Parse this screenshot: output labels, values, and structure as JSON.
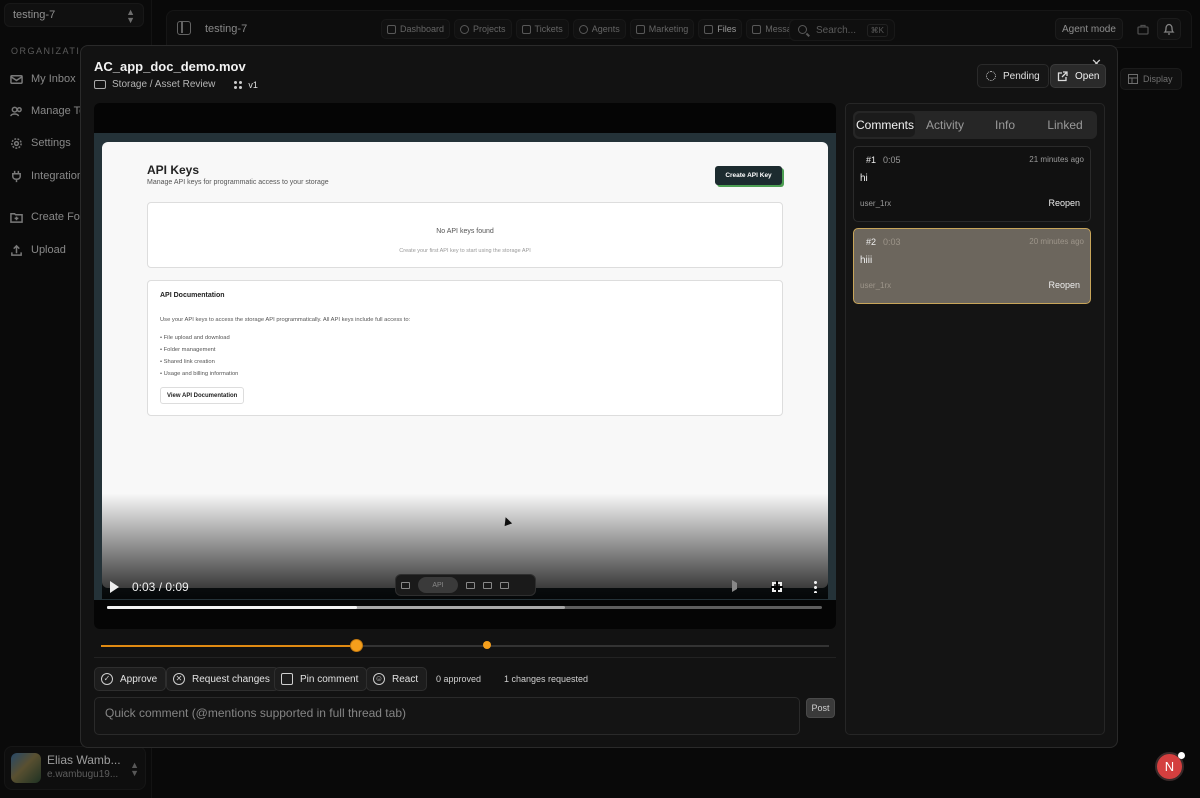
{
  "sidebar": {
    "workspace": "testing-7",
    "section_label": "ORGANIZATION",
    "items": [
      {
        "label": "My Inbox"
      },
      {
        "label": "Manage Te"
      },
      {
        "label": "Settings"
      },
      {
        "label": "Integration"
      },
      {
        "label": "Create Fol"
      },
      {
        "label": "Upload"
      }
    ],
    "user": {
      "name": "Elias Wamb...",
      "email": "e.wambugu19..."
    }
  },
  "topbar": {
    "title": "testing-7",
    "tabs": [
      {
        "label": "Dashboard"
      },
      {
        "label": "Projects"
      },
      {
        "label": "Tickets"
      },
      {
        "label": "Agents"
      },
      {
        "label": "Marketing"
      },
      {
        "label": "Files"
      },
      {
        "label": "Messages"
      }
    ],
    "search_placeholder": "Search...",
    "search_shortcut": "⌘K",
    "agent_mode_label": "Agent mode",
    "display_label": "Display"
  },
  "modal": {
    "filename": "AC_app_doc_demo.mov",
    "breadcrumb": "Storage / Asset Review",
    "version": "v1",
    "status_label": "Pending",
    "open_label": "Open",
    "close_glyph": "✕"
  },
  "video_content": {
    "heading": "API Keys",
    "subheading": "Manage API keys for programmatic access to your storage",
    "create_button": "Create API Key",
    "empty_title": "No API keys found",
    "empty_sub": "Create your first API key to start using the storage API",
    "doc_title": "API Documentation",
    "doc_desc": "Use your API keys to access the storage API programmatically. All API keys include full access to:",
    "doc_items": [
      "• File upload and download",
      "• Folder management",
      "• Shared link creation",
      "• Usage and billing information"
    ],
    "doc_button": "View API Documentation",
    "toolbar_pill": "API"
  },
  "player": {
    "time": "0:03 / 0:09",
    "progress": 0.35,
    "buffered": 0.64
  },
  "timeline": {
    "playhead": 0.35,
    "marker": 0.53
  },
  "actions": {
    "approve": "Approve",
    "request_changes": "Request changes",
    "pin_comment": "Pin comment",
    "react": "React",
    "approved_count": "0 approved",
    "changes_count": "1 changes requested"
  },
  "quick_comment": {
    "placeholder": "Quick comment (@mentions supported in full thread tab)",
    "post_label": "Post"
  },
  "right_panel": {
    "tabs": [
      {
        "label": "Comments",
        "active": true
      },
      {
        "label": "Activity"
      },
      {
        "label": "Info"
      },
      {
        "label": "Linked"
      }
    ],
    "comments": [
      {
        "num": "#1",
        "ts": "0:05",
        "ago": "21 minutes ago",
        "body": "hi",
        "user": "user_1rx",
        "action": "Reopen"
      },
      {
        "num": "#2",
        "ts": "0:03",
        "ago": "20 minutes ago",
        "body": "hiii",
        "user": "user_1rx",
        "action": "Reopen"
      }
    ]
  },
  "badge": {
    "letter": "N"
  },
  "colors": {
    "accent": "#f59f1c",
    "badge": "#d43f3f",
    "selected_border": "#c8a55a"
  }
}
